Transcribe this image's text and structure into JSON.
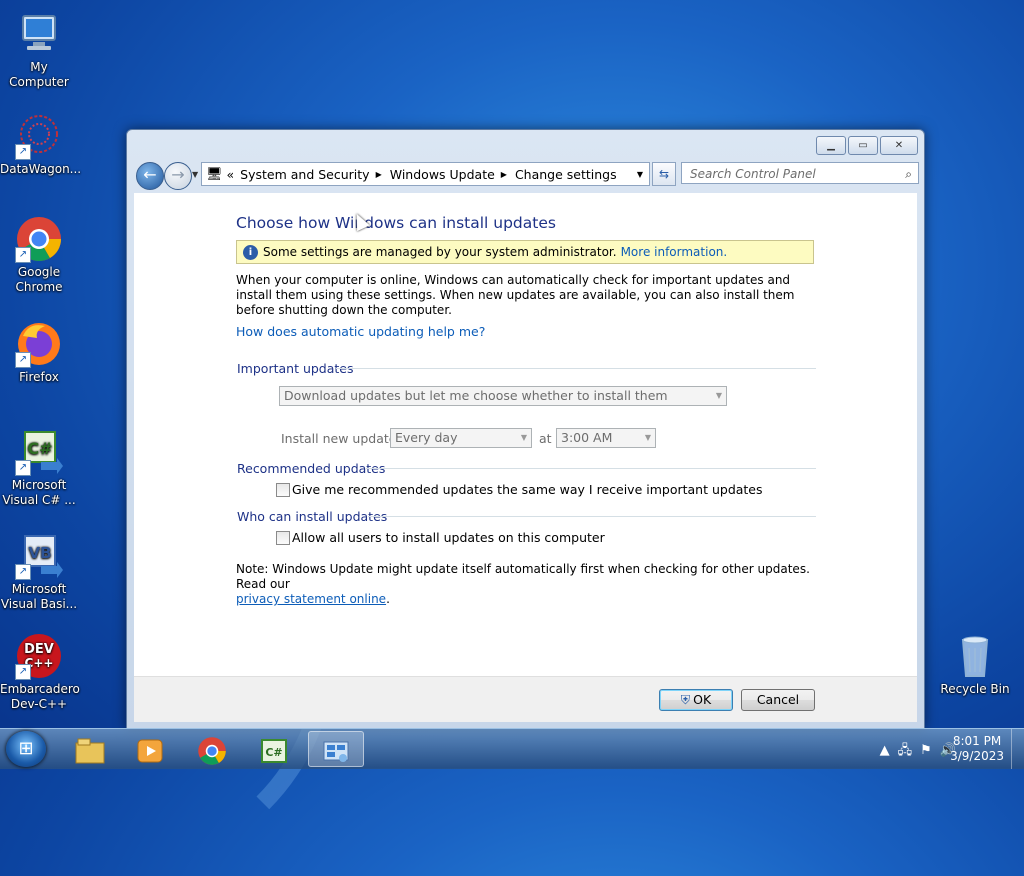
{
  "desktop": {
    "icons": [
      {
        "label": "My Computer"
      },
      {
        "label": "DataWagon..."
      },
      {
        "label": "Google Chrome"
      },
      {
        "label": "Firefox"
      },
      {
        "label": "Microsoft Visual C# ..."
      },
      {
        "label": "Microsoft Visual Basi..."
      },
      {
        "label": "Embarcadero Dev-C++"
      },
      {
        "label": "Recycle Bin"
      }
    ]
  },
  "window": {
    "address": {
      "prefix": "«",
      "crumbs": [
        "System and Security",
        "Windows Update",
        "Change settings"
      ]
    },
    "search_placeholder": "Search Control Panel",
    "title": "Choose how Windows can install updates",
    "info_text": "Some settings are managed by your system administrator.",
    "info_link": "More information.",
    "description": "When your computer is online, Windows can automatically check for important updates and install them using these settings. When new updates are available, you can also install them before shutting down the computer.",
    "help_link": "How does automatic updating help me?",
    "important": {
      "heading": "Important updates",
      "mode": "Download updates but let me choose whether to install them",
      "install_label": "Install new updates:",
      "day": "Every day",
      "at_label": "at",
      "time": "3:00 AM"
    },
    "recommended": {
      "heading": "Recommended updates",
      "checkbox_label": "Give me recommended updates the same way I receive important updates",
      "checked": false
    },
    "who": {
      "heading": "Who can install updates",
      "checkbox_label": "Allow all users to install updates on this computer",
      "checked": false
    },
    "note_text": "Note: Windows Update might update itself automatically first when checking for other updates.  Read our",
    "note_link": "privacy statement online",
    "note_end": ".",
    "ok_label": "OK",
    "cancel_label": "Cancel"
  },
  "taskbar": {
    "time": "8:01 PM",
    "date": "3/9/2023"
  }
}
